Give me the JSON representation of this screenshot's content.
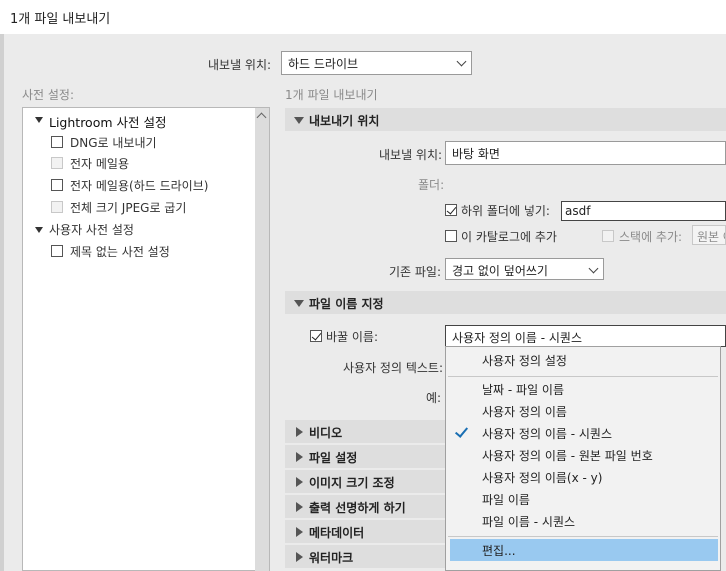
{
  "window": {
    "title": "1개 파일 내보내기"
  },
  "export_to": {
    "label": "내보낼 위치:",
    "value": "하드 드라이브"
  },
  "presets": {
    "header": "사전 설정:",
    "groups": [
      {
        "label": "Lightroom 사전 설정",
        "items": [
          {
            "label": "DNG로 내보내기",
            "enabled": true
          },
          {
            "label": "전자 메일용",
            "enabled": false
          },
          {
            "label": "전자 메일용(하드 드라이브)",
            "enabled": true
          },
          {
            "label": "전체 크기 JPEG로 굽기",
            "enabled": false
          }
        ]
      },
      {
        "label": "사용자 사전 설정",
        "items": [
          {
            "label": "제목 없는 사전 설정",
            "enabled": true
          }
        ]
      }
    ]
  },
  "right_header": "1개 파일 내보내기",
  "export_location": {
    "title": "내보내기 위치",
    "export_to_label": "내보낼 위치:",
    "export_to_value": "바탕 화면",
    "folder_label": "폴더:",
    "subfolder_label": "하위 폴더에 넣기:",
    "subfolder_checked": true,
    "subfolder_value": "asdf",
    "add_catalog_label": "이 카탈로그에 추가",
    "add_stack_label": "스택에 추가:",
    "stack_value": "원본 아",
    "existing_label": "기존 파일:",
    "existing_value": "경고 없이 덮어쓰기"
  },
  "file_naming": {
    "title": "파일 이름 지정",
    "rename_label": "바꿀 이름:",
    "rename_checked": true,
    "rename_value": "사용자 정의 이름 - 시퀀스",
    "custom_text_label": "사용자 정의 텍스트:",
    "example_label": "예:"
  },
  "collapsed_sections": [
    "비디오",
    "파일 설정",
    "이미지 크기 조정",
    "출력 선명하게 하기",
    "메타데이터",
    "워터마크"
  ],
  "rename_menu": {
    "items": [
      {
        "label": "사용자 정의 설정"
      },
      {
        "label": "날짜 - 파일 이름"
      },
      {
        "label": "사용자 정의 이름"
      },
      {
        "label": "사용자 정의 이름 - 시퀀스",
        "checked": true
      },
      {
        "label": "사용자 정의 이름 - 원본 파일 번호"
      },
      {
        "label": "사용자 정의 이름(x - y)"
      },
      {
        "label": "파일 이름"
      },
      {
        "label": "파일 이름 - 시퀀스"
      },
      {
        "label": "편집...",
        "highlighted": true
      }
    ]
  }
}
